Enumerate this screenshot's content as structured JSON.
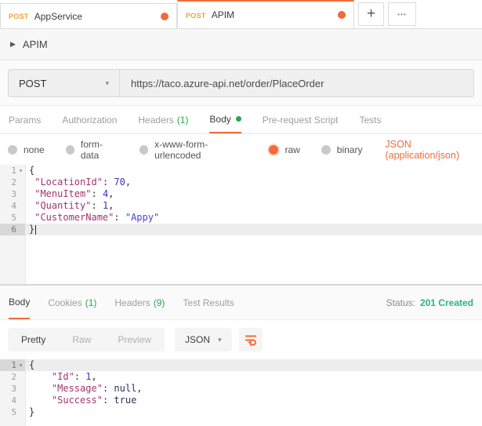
{
  "icons": {
    "caret_right": "▶",
    "chevron_down": "▾",
    "fold_caret": "▾",
    "plus": "+",
    "more": "•••"
  },
  "colors": {
    "accent_orange": "#f26b3a",
    "method_orange": "#f0a330",
    "count_green": "#29a746",
    "status_green": "#29b388"
  },
  "tabs": {
    "items": [
      {
        "method": "POST",
        "title": "AppService",
        "modified": true
      },
      {
        "method": "POST",
        "title": "APIM",
        "modified": true,
        "active": true
      }
    ]
  },
  "collection": {
    "title": "APIM"
  },
  "request": {
    "method": "POST",
    "url": "https://taco.azure-api.net/order/PlaceOrder",
    "tabs": [
      {
        "label": "Params"
      },
      {
        "label": "Authorization"
      },
      {
        "label": "Headers",
        "count": "(1)"
      },
      {
        "label": "Body",
        "active": true,
        "dot": true
      },
      {
        "label": "Pre-request Script"
      },
      {
        "label": "Tests"
      }
    ],
    "body_modes": [
      "none",
      "form-data",
      "x-www-form-urlencoded",
      "raw",
      "binary"
    ],
    "selected_mode": "raw",
    "content_type": "JSON (application/json)",
    "editor": {
      "lines": [
        {
          "num": "1",
          "fold": true,
          "segs": [
            {
              "c": "p",
              "t": "{"
            }
          ]
        },
        {
          "num": "2",
          "segs": [
            {
              "c": "p",
              "t": " "
            },
            {
              "c": "k",
              "t": "\"LocationId\""
            },
            {
              "c": "p",
              "t": ": "
            },
            {
              "c": "n",
              "t": "70"
            },
            {
              "c": "p",
              "t": ","
            }
          ]
        },
        {
          "num": "3",
          "segs": [
            {
              "c": "p",
              "t": " "
            },
            {
              "c": "k",
              "t": "\"MenuItem\""
            },
            {
              "c": "p",
              "t": ": "
            },
            {
              "c": "n",
              "t": "4"
            },
            {
              "c": "p",
              "t": ","
            }
          ]
        },
        {
          "num": "4",
          "segs": [
            {
              "c": "p",
              "t": " "
            },
            {
              "c": "k",
              "t": "\"Quantity\""
            },
            {
              "c": "p",
              "t": ": "
            },
            {
              "c": "n",
              "t": "1"
            },
            {
              "c": "p",
              "t": ","
            }
          ]
        },
        {
          "num": "5",
          "segs": [
            {
              "c": "p",
              "t": " "
            },
            {
              "c": "k",
              "t": "\"CustomerName\""
            },
            {
              "c": "p",
              "t": ": "
            },
            {
              "c": "s",
              "t": "\"Appy\""
            }
          ]
        },
        {
          "num": "6",
          "active": true,
          "cursor": true,
          "segs": [
            {
              "c": "p",
              "t": "}"
            }
          ]
        }
      ]
    }
  },
  "response": {
    "tabs": [
      {
        "label": "Body",
        "active": true
      },
      {
        "label": "Cookies",
        "count": "(1)"
      },
      {
        "label": "Headers",
        "count": "(9)"
      },
      {
        "label": "Test Results"
      }
    ],
    "status_label": "Status:",
    "status_value": "201 Created",
    "views": [
      {
        "label": "Pretty",
        "active": true
      },
      {
        "label": "Raw"
      },
      {
        "label": "Preview"
      }
    ],
    "format": "JSON",
    "editor": {
      "lines": [
        {
          "num": "1",
          "fold": true,
          "active": true,
          "segs": [
            {
              "c": "p",
              "t": "{"
            }
          ]
        },
        {
          "num": "2",
          "segs": [
            {
              "c": "p",
              "t": "    "
            },
            {
              "c": "k",
              "t": "\"Id\""
            },
            {
              "c": "p",
              "t": ": "
            },
            {
              "c": "n",
              "t": "1"
            },
            {
              "c": "p",
              "t": ","
            }
          ]
        },
        {
          "num": "3",
          "segs": [
            {
              "c": "p",
              "t": "    "
            },
            {
              "c": "k",
              "t": "\"Message\""
            },
            {
              "c": "p",
              "t": ": "
            },
            {
              "c": "w",
              "t": "null"
            },
            {
              "c": "p",
              "t": ","
            }
          ]
        },
        {
          "num": "4",
          "segs": [
            {
              "c": "p",
              "t": "    "
            },
            {
              "c": "k",
              "t": "\"Success\""
            },
            {
              "c": "p",
              "t": ": "
            },
            {
              "c": "w",
              "t": "true"
            }
          ]
        },
        {
          "num": "5",
          "segs": [
            {
              "c": "p",
              "t": "}"
            }
          ]
        }
      ]
    }
  }
}
